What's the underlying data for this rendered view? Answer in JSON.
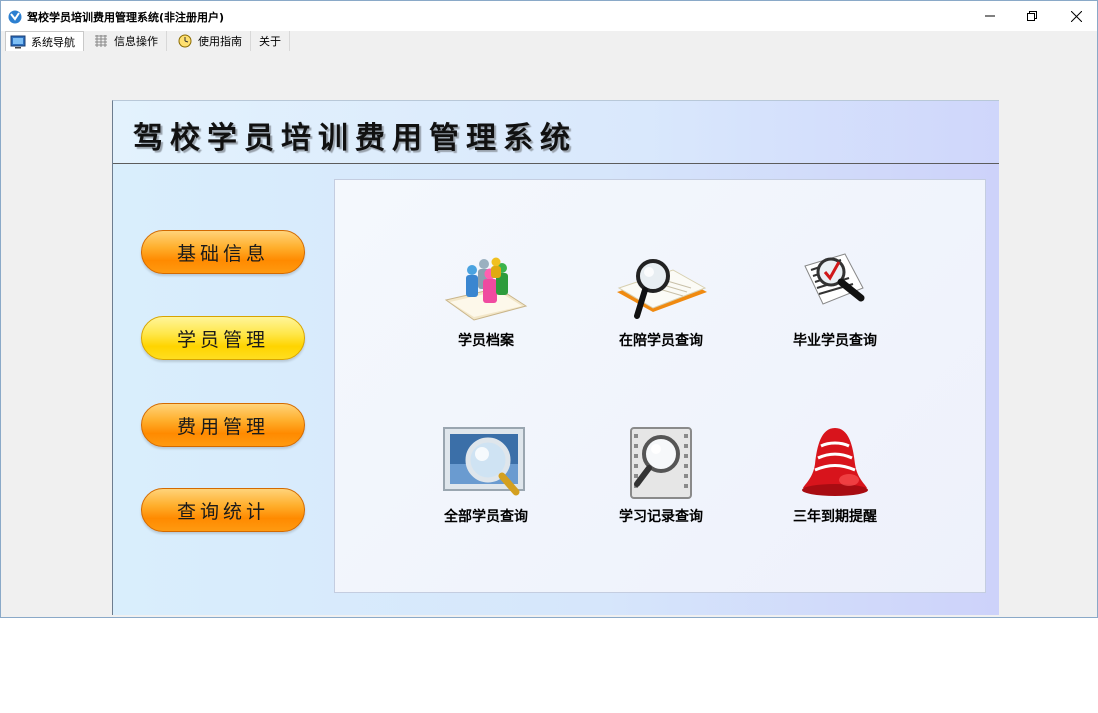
{
  "window": {
    "title": "驾校学员培训费用管理系统(非注册用户)"
  },
  "tabs": [
    {
      "label": "系统导航",
      "icon": "monitor-icon",
      "active": true
    },
    {
      "label": "信息操作",
      "icon": "grid-icon",
      "active": false
    },
    {
      "label": "使用指南",
      "icon": "clock-icon",
      "active": false
    },
    {
      "label": "关于",
      "icon": "",
      "active": false
    }
  ],
  "header": {
    "title": "驾校学员培训费用管理系统"
  },
  "sidebar": {
    "buttons": [
      {
        "label": "基础信息",
        "color": "orange"
      },
      {
        "label": "学员管理",
        "color": "yellow"
      },
      {
        "label": "费用管理",
        "color": "orange"
      },
      {
        "label": "查询统计",
        "color": "orange"
      }
    ]
  },
  "tiles": [
    {
      "label": "学员档案",
      "icon": "people-icon"
    },
    {
      "label": "在陪学员查询",
      "icon": "book-search-icon"
    },
    {
      "label": "毕业学员查询",
      "icon": "document-search-icon"
    },
    {
      "label": "全部学员查询",
      "icon": "picture-search-icon"
    },
    {
      "label": "学习记录查询",
      "icon": "film-search-icon"
    },
    {
      "label": "三年到期提醒",
      "icon": "bell-icon"
    }
  ],
  "colors": {
    "button_orange": "#ff8a00",
    "button_yellow": "#ffd400",
    "window_border": "#8aa9c8"
  }
}
